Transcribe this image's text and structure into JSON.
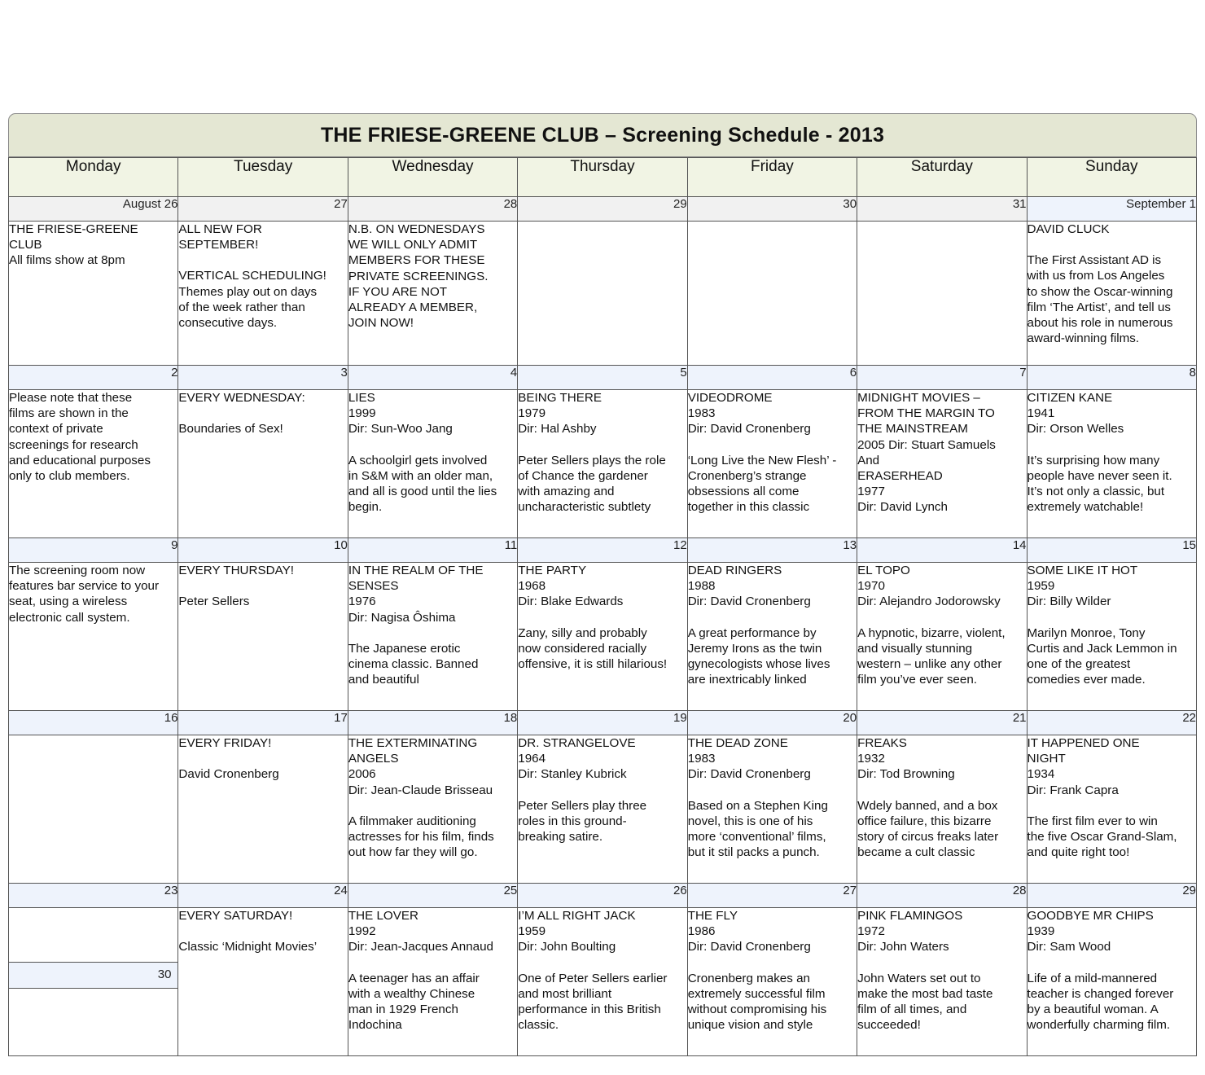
{
  "header": {
    "title": "THE FRIESE-GREENE CLUB – Screening Schedule - 2013"
  },
  "day_headers": [
    "Monday",
    "Tuesday",
    "Wednesday",
    "Thursday",
    "Friday",
    "Saturday",
    "Sunday"
  ],
  "colors": {
    "title_band": "#e4e7d3",
    "day_header": "#f1f4e4",
    "date_row_blue": "#eef3fc",
    "date_row_grey": "#f1f1f1",
    "wednesday_tint": "#f9cfa2",
    "thursday_tint": "#d6d3e8",
    "friday_tint": "#f6d2cd",
    "saturday_tint": "#e4e4e4",
    "sunday_tint": "#ccdaa2",
    "grid_line": "#555555"
  },
  "weeks": [
    {
      "dates": [
        "August 26",
        "27",
        "28",
        "29",
        "30",
        "31",
        "September 1"
      ],
      "date_styles": [
        "aug",
        "aug",
        "aug",
        "aug",
        "aug",
        "aug",
        "sep"
      ],
      "cells": [
        {
          "tint": "none",
          "lines": [
            "THE FRIESE-GREENE",
            "CLUB",
            "All films show at 8pm"
          ]
        },
        {
          "tint": "none",
          "lines": [
            "ALL NEW FOR",
            "SEPTEMBER!",
            "",
            "VERTICAL SCHEDULING!",
            "Themes play out on days",
            "of the week rather than",
            "consecutive days."
          ]
        },
        {
          "tint": "none",
          "lines": [
            "N.B. ON WEDNESDAYS",
            "WE WILL ONLY ADMIT",
            "MEMBERS FOR THESE",
            "PRIVATE SCREENINGS.",
            "IF YOU ARE NOT",
            "ALREADY A MEMBER,",
            "JOIN NOW!"
          ]
        },
        {
          "tint": "grey",
          "lines": []
        },
        {
          "tint": "grey",
          "lines": []
        },
        {
          "tint": "grey",
          "lines": []
        },
        {
          "tint": "green",
          "lines": [
            "DAVID CLUCK",
            "",
            "The First Assistant AD is",
            "with us from Los Angeles",
            "to show the Oscar-winning",
            "film ‘The Artist’, and tell us",
            "about his role in numerous",
            "award-winning films."
          ]
        }
      ]
    },
    {
      "dates": [
        "2",
        "3",
        "4",
        "5",
        "6",
        "7",
        "8"
      ],
      "date_styles": [
        "sep",
        "sep",
        "sep",
        "sep",
        "sep",
        "sep",
        "sep"
      ],
      "cells": [
        {
          "tint": "none",
          "lines": [
            "Please note that these",
            "films are shown in the",
            "context of private",
            "screenings for research",
            "and educational purposes",
            "only to club members."
          ]
        },
        {
          "tint": "none",
          "lines": [
            "EVERY WEDNESDAY:",
            "",
            "Boundaries of Sex!"
          ]
        },
        {
          "tint": "orange",
          "lines": [
            "LIES",
            "1999",
            "Dir: Sun-Woo Jang",
            "",
            "A schoolgirl gets involved",
            "in S&M with an older man,",
            "and all is good until the lies",
            "begin."
          ]
        },
        {
          "tint": "purple",
          "lines": [
            "BEING THERE",
            "1979",
            "Dir: Hal Ashby",
            "",
            "Peter Sellers plays the role",
            "of Chance the gardener",
            "with amazing and",
            "uncharacteristic subtlety"
          ]
        },
        {
          "tint": "pink",
          "lines": [
            "VIDEODROME",
            "1983",
            "Dir: David Cronenberg",
            "",
            "‘Long Live the New Flesh’ -",
            "Cronenberg’s strange",
            "obsessions all come",
            "together in this classic"
          ]
        },
        {
          "tint": "lgrey",
          "lines": [
            "MIDNIGHT MOVIES –",
            "FROM THE MARGIN TO",
            "THE MAINSTREAM",
            "2005 Dir: Stuart Samuels",
            "And",
            "ERASERHEAD",
            "1977",
            "Dir: David Lynch"
          ]
        },
        {
          "tint": "green",
          "lines": [
            "CITIZEN KANE",
            "1941",
            "Dir: Orson Welles",
            "",
            "It’s surprising how many",
            "people have never seen it.",
            "It’s not only a classic, but",
            "extremely watchable!"
          ]
        }
      ]
    },
    {
      "dates": [
        "9",
        "10",
        "11",
        "12",
        "13",
        "14",
        "15"
      ],
      "date_styles": [
        "sep",
        "sep",
        "sep",
        "sep",
        "sep",
        "sep",
        "sep"
      ],
      "cells": [
        {
          "tint": "none",
          "lines": [
            "The screening room now",
            "features bar service to your",
            "seat, using a wireless",
            "electronic call system."
          ]
        },
        {
          "tint": "none",
          "lines": [
            "EVERY THURSDAY!",
            "",
            "Peter Sellers"
          ]
        },
        {
          "tint": "orange",
          "lines": [
            "IN THE REALM OF THE",
            "SENSES",
            "1976",
            "Dir: Nagisa Ôshima",
            "",
            "The Japanese erotic",
            "cinema classic. Banned",
            "and beautiful"
          ]
        },
        {
          "tint": "purple",
          "lines": [
            "THE PARTY",
            "1968",
            "Dir: Blake Edwards",
            "",
            "Zany, silly and probably",
            "now considered racially",
            "offensive, it is still hilarious!"
          ]
        },
        {
          "tint": "pink",
          "lines": [
            "DEAD RINGERS",
            "1988",
            "Dir: David Cronenberg",
            "",
            "A great performance by",
            "Jeremy Irons as the twin",
            "gynecologists whose lives",
            "are inextricably linked"
          ]
        },
        {
          "tint": "lgrey",
          "lines": [
            "EL TOPO",
            "1970",
            "Dir: Alejandro Jodorowsky",
            "",
            "A hypnotic, bizarre, violent,",
            "and visually stunning",
            "western – unlike any other",
            "film you’ve ever seen."
          ]
        },
        {
          "tint": "green",
          "lines": [
            "SOME LIKE IT HOT",
            "1959",
            "Dir: Billy Wilder",
            "",
            "Marilyn Monroe, Tony",
            "Curtis and Jack Lemmon in",
            "one of the greatest",
            "comedies ever made."
          ]
        }
      ]
    },
    {
      "dates": [
        "16",
        "17",
        "18",
        "19",
        "20",
        "21",
        "22"
      ],
      "date_styles": [
        "sep",
        "sep",
        "sep",
        "sep",
        "sep",
        "sep",
        "sep"
      ],
      "cells": [
        {
          "tint": "none",
          "lines": []
        },
        {
          "tint": "none",
          "lines": [
            "EVERY FRIDAY!",
            "",
            "David Cronenberg"
          ]
        },
        {
          "tint": "orange",
          "lines": [
            "THE EXTERMINATING",
            "ANGELS",
            "2006",
            "Dir: Jean-Claude Brisseau",
            "",
            "A filmmaker auditioning",
            "actresses for his film, finds",
            "out how far they will go."
          ]
        },
        {
          "tint": "purple",
          "lines": [
            "DR. STRANGELOVE",
            "1964",
            "Dir: Stanley Kubrick",
            "",
            "Peter Sellers play three",
            "roles in this ground-",
            "breaking satire."
          ]
        },
        {
          "tint": "pink",
          "lines": [
            "THE DEAD ZONE",
            "1983",
            "Dir: David Cronenberg",
            "",
            "Based on a Stephen King",
            "novel, this is one of his",
            "more ‘conventional’ films,",
            "but it stil packs a punch."
          ]
        },
        {
          "tint": "lgrey",
          "lines": [
            "FREAKS",
            "1932",
            "Dir: Tod Browning",
            "",
            "Wdely banned, and a box",
            "office failure, this bizarre",
            "story of circus freaks later",
            "became a cult classic"
          ]
        },
        {
          "tint": "green",
          "lines": [
            "IT HAPPENED ONE",
            "NIGHT",
            "1934",
            "Dir: Frank Capra",
            "",
            "The first film ever to win",
            "the five Oscar Grand-Slam,",
            "and quite right too!"
          ]
        }
      ]
    },
    {
      "dates": [
        "23",
        "24",
        "25",
        "26",
        "27",
        "28",
        "29"
      ],
      "date_styles": [
        "sep",
        "sep",
        "sep",
        "sep",
        "sep",
        "sep",
        "sep"
      ],
      "monday_split_date": "30",
      "cells": [
        {
          "tint": "none",
          "lines": []
        },
        {
          "tint": "none",
          "lines": [
            "EVERY SATURDAY!",
            "",
            "Classic ‘Midnight Movies’"
          ]
        },
        {
          "tint": "orange",
          "lines": [
            "THE LOVER",
            "1992",
            "Dir: Jean-Jacques Annaud",
            "",
            "A teenager has an affair",
            "with a wealthy Chinese",
            "man in 1929 French",
            "Indochina"
          ]
        },
        {
          "tint": "purple",
          "lines": [
            "I’M ALL RIGHT JACK",
            "1959",
            "Dir: John Boulting",
            "",
            "One of Peter Sellers earlier",
            "and most brilliant",
            "performance in this British",
            "classic."
          ]
        },
        {
          "tint": "pink",
          "lines": [
            "THE FLY",
            "1986",
            "Dir: David Cronenberg",
            "",
            "Cronenberg makes an",
            "extremely successful film",
            "without compromising his",
            "unique vision and style"
          ]
        },
        {
          "tint": "lgrey",
          "lines": [
            "PINK FLAMINGOS",
            "1972",
            "Dir: John Waters",
            "",
            "John Waters set out to",
            "make the most bad taste",
            "film of all times, and",
            "succeeded!"
          ]
        },
        {
          "tint": "green",
          "lines": [
            "GOODBYE MR CHIPS",
            "1939",
            "Dir: Sam Wood",
            "",
            "Life of a mild-mannered",
            "teacher is changed forever",
            "by a beautiful woman. A",
            "wonderfully charming film."
          ]
        }
      ]
    }
  ]
}
